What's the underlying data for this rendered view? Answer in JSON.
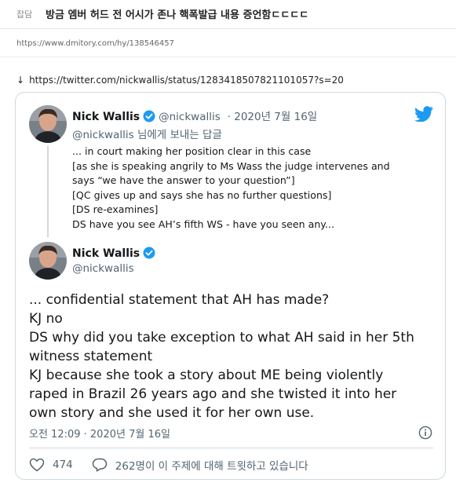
{
  "post": {
    "category": "잡담",
    "title": "방금 엠버 허드 전 어시가 존나 핵폭발급 내용 증언함ㄷㄷㄷㄷ",
    "source_url": "https://www.dmitory.com/hy/138546457"
  },
  "tweet_link": {
    "arrow": "↓",
    "url": "https://twitter.com/nickwallis/status/1283418507821101057?s=20"
  },
  "reply": {
    "name": "Nick Wallis",
    "handle": "@nickwallis",
    "date": "· 2020년 7월 16일",
    "replying_to": "@nickwallis 님에게 보내는 답글",
    "lines": [
      "... in court making her position clear in this case",
      "[as she is speaking angrily to Ms Wass the judge intervenes and",
      "says “we have the answer to your question”]",
      "[QC gives up and says she has no further questions]",
      "[DS re-examines]",
      "DS have you see AH’s fifth WS - have you seen any..."
    ]
  },
  "main": {
    "name": "Nick Wallis",
    "handle": "@nickwallis",
    "lines": [
      "... confidential statement that AH has made?",
      "KJ no",
      "DS why did you take exception to what AH said in her 5th",
      "witness statement",
      "KJ because she took a story about ME being violently",
      "raped in Brazil 26 years ago and she twisted it into her",
      "own story and she used it for her own use."
    ],
    "timestamp": "오전 12:09 · 2020년 7월 16일"
  },
  "stats": {
    "likes": "474",
    "talking": "262명이 이 주제에 대해 트윗하고 있습니다"
  },
  "icons": {
    "verified": "verified-badge-icon",
    "twitter": "twitter-bird-icon",
    "info": "info-icon",
    "heart": "heart-icon",
    "reply": "speech-bubble-icon"
  },
  "colors": {
    "twitter_blue": "#1d9bf0",
    "secondary_text": "#536471",
    "border": "#cfd9de"
  }
}
